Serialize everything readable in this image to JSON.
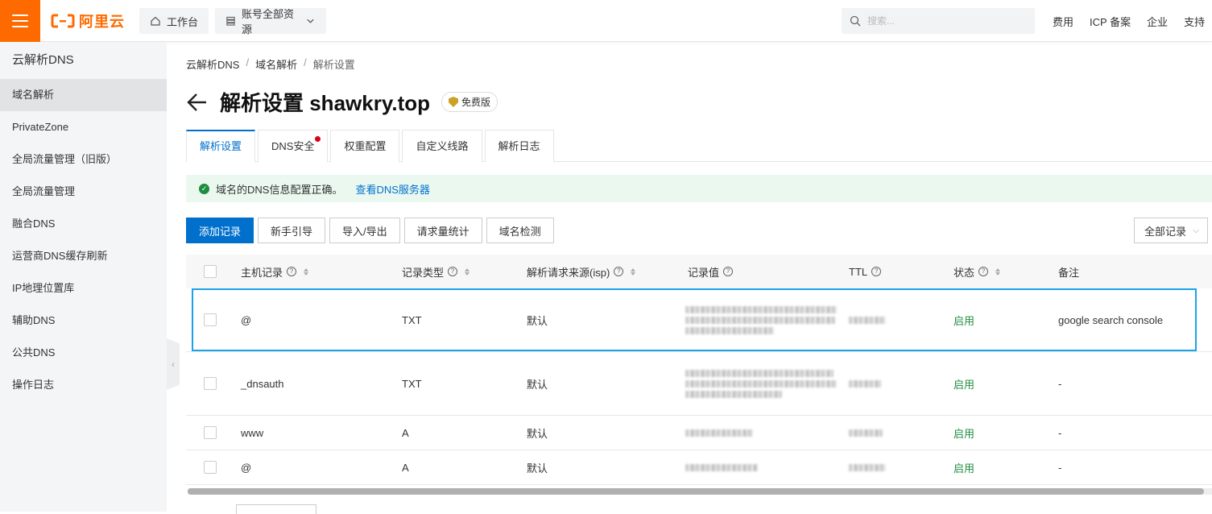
{
  "topbar": {
    "logo_text": "阿里云",
    "workbench": "工作台",
    "resources": "账号全部资源",
    "search_placeholder": "搜索...",
    "links": [
      "费用",
      "ICP 备案",
      "企业",
      "支持"
    ],
    "brand_color": "#ff6a00"
  },
  "sidebar": {
    "title": "云解析DNS",
    "items": [
      {
        "label": "域名解析",
        "active": true
      },
      {
        "label": "PrivateZone"
      },
      {
        "label": "全局流量管理（旧版）"
      },
      {
        "label": "全局流量管理"
      },
      {
        "label": "融合DNS"
      },
      {
        "label": "运营商DNS缓存刷新"
      },
      {
        "label": "IP地理位置库"
      },
      {
        "label": "辅助DNS"
      },
      {
        "label": "公共DNS"
      },
      {
        "label": "操作日志"
      }
    ]
  },
  "breadcrumb": [
    "云解析DNS",
    "域名解析",
    "解析设置"
  ],
  "page": {
    "title": "解析设置 shawkry.top",
    "badge": "免费版"
  },
  "tabs": [
    "解析设置",
    "DNS安全",
    "权重配置",
    "自定义线路",
    "解析日志"
  ],
  "notice": {
    "text": "域名的DNS信息配置正确。",
    "link": "查看DNS服务器"
  },
  "actions": [
    "添加记录",
    "新手引导",
    "导入/导出",
    "请求量统计",
    "域名检测"
  ],
  "filter": "全部记录",
  "table": {
    "columns": [
      "主机记录",
      "记录类型",
      "解析请求来源(isp)",
      "记录值",
      "TTL",
      "状态",
      "备注"
    ],
    "rows": [
      {
        "host": "@",
        "type": "TXT",
        "isp": "默认",
        "status": "启用",
        "remark": "google search console"
      },
      {
        "host": "_dnsauth",
        "type": "TXT",
        "isp": "默认",
        "status": "启用",
        "remark": "-"
      },
      {
        "host": "www",
        "type": "A",
        "isp": "默认",
        "status": "启用",
        "remark": "-"
      },
      {
        "host": "@",
        "type": "A",
        "isp": "默认",
        "status": "启用",
        "remark": "-"
      }
    ]
  }
}
